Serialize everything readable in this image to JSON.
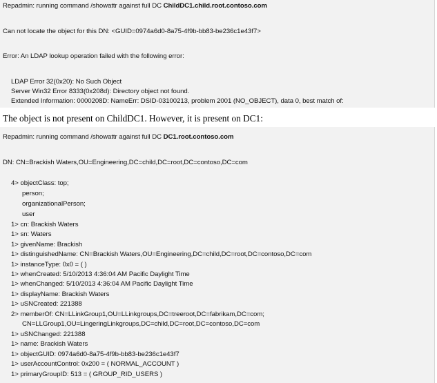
{
  "section1": {
    "cmd_prefix": "Repadmin: running command /showattr against full DC ",
    "cmd_server": "ChildDC1.child.root.contoso.com",
    "locate_error": "Can not locate the object for this DN: <GUID=0974a6d0-8a75-4f9b-bb83-be236c1e43f7>",
    "ldap_error": "Error: An LDAP lookup operation failed with the following error:",
    "ldap_code": "LDAP Error 32(0x20): No Such Object",
    "win32_error": "Server Win32 Error 8333(0x208d): Directory object not found.",
    "extended_info": "Extended Information: 0000208D: NameErr: DSID-03100213, problem 2001 (NO_OBJECT), data 0, best match of:"
  },
  "prose": {
    "statement": "The object is not present on ChildDC1.  However, it is present on DC1:"
  },
  "section2": {
    "cmd_prefix": "Repadmin: running command /showattr against full DC ",
    "cmd_server": "DC1.root.contoso.com",
    "dn": "DN: CN=Brackish Waters,OU=Engineering,DC=child,DC=root,DC=contoso,DC=com",
    "objectclass": "4> objectClass: top;",
    "oc_person": "person;",
    "oc_orgperson": "organizationalPerson;",
    "oc_user": "user",
    "cn": "1> cn: Brackish Waters",
    "sn": "1> sn: Waters",
    "givenname": "1> givenName: Brackish",
    "distinguishedname": "1> distinguishedName: CN=Brackish Waters,OU=Engineering,DC=child,DC=root,DC=contoso,DC=com",
    "instancetype": "1> instanceType: 0x0 = ( )",
    "whencreated": "1> whenCreated: 5/10/2013 4:36:04 AM Pacific Daylight Time",
    "whenchanged": "1> whenChanged: 5/10/2013 4:36:04 AM Pacific Daylight Time",
    "displayname": "1> displayName: Brackish Waters",
    "usncreated": "1> uSNCreated: 221388",
    "memberof_1": "2> memberOf: CN=LLinkGroup1,OU=LLinkgroups,DC=treeroot,DC=fabrikam,DC=com;",
    "memberof_2": "CN=LLGroup1,OU=LingeringLinkgroups,DC=child,DC=root,DC=contoso,DC=com",
    "usnchanged": "1> uSNChanged: 221388",
    "name": "1> name: Brackish Waters",
    "objectguid": "1> objectGUID: 0974a6d0-8a75-4f9b-bb83-be236c1e43f7",
    "useraccountcontrol": "1> userAccountControl: 0x200 = ( NORMAL_ACCOUNT )",
    "primarygroupid": "1> primaryGroupID: 513 = ( GROUP_RID_USERS )"
  }
}
